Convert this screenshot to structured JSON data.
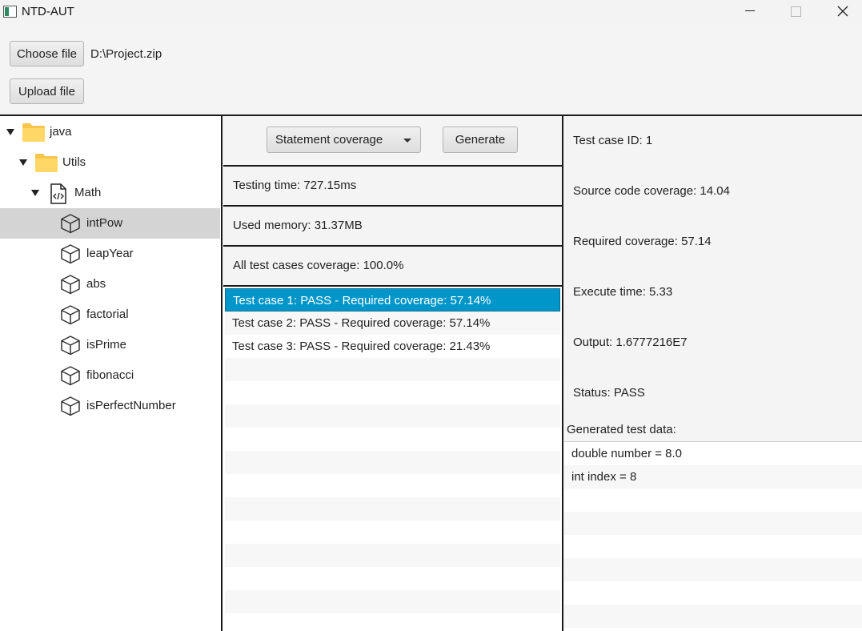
{
  "window": {
    "title": "NTD-AUT"
  },
  "toolbar": {
    "choose_label": "Choose file",
    "file_path": "D:\\Project.zip",
    "upload_label": "Upload file"
  },
  "tree": {
    "root": "java",
    "package": "Utils",
    "class": "Math",
    "methods": [
      "intPow",
      "leapYear",
      "abs",
      "factorial",
      "isPrime",
      "fibonacci",
      "isPerfectNumber"
    ],
    "selected": "intPow"
  },
  "middle": {
    "coverage_select": "Statement coverage",
    "generate_label": "Generate",
    "testing_time": "Testing time: 727.15ms",
    "used_memory": "Used memory: 31.37MB",
    "all_coverage": "All test cases coverage: 100.0%",
    "test_cases": [
      "Test case 1: PASS - Required coverage: 57.14%",
      "Test case 2: PASS - Required coverage: 57.14%",
      "Test case 3: PASS - Required coverage: 21.43%"
    ]
  },
  "details": {
    "test_case_id": "Test case ID: 1",
    "source_coverage": "Source code coverage: 14.04",
    "required_coverage": "Required coverage: 57.14",
    "execute_time": "Execute time: 5.33",
    "output": "Output: 1.6777216E7",
    "status": "Status: PASS",
    "generated_label": "Generated test data:",
    "generated_data": [
      "double number = 8.0",
      "int index = 8"
    ]
  },
  "colors": {
    "selection": "#0096c9",
    "tree_selection": "#d4d4d4",
    "folder": "#f6c54a"
  }
}
